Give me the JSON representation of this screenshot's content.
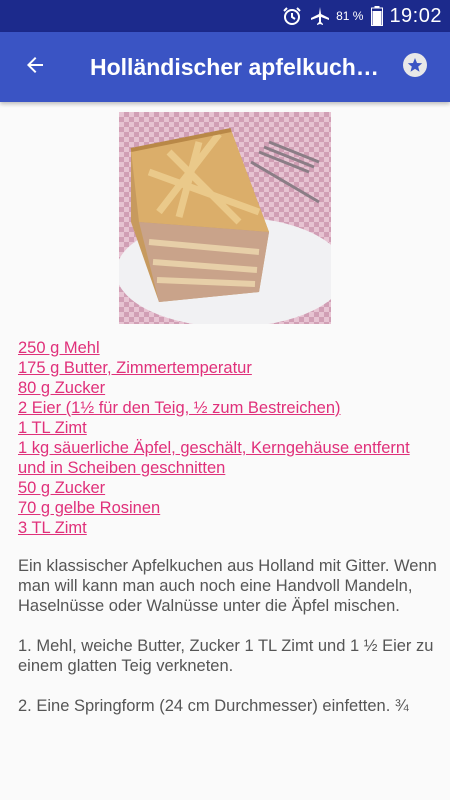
{
  "status_bar": {
    "battery_percent": "81 %",
    "time": "19:02",
    "icons": [
      "alarm-icon",
      "airplane-icon",
      "battery-icon"
    ]
  },
  "app_bar": {
    "title": "Holländischer apfelkuchen",
    "back_icon": "arrow-left-icon",
    "favorite_icon": "star-icon"
  },
  "recipe": {
    "image_alt": "Apfelkuchen",
    "ingredients": [
      "250 g Mehl",
      "175 g Butter, Zimmertemperatur",
      "80 g Zucker",
      "2 Eier (1½ für den Teig, ½ zum Bestreichen)",
      "1 TL Zimt",
      "1 kg säuerliche Äpfel, geschält, Kerngehäuse entfernt und in Scheiben geschnitten",
      "50 g Zucker",
      "70 g gelbe Rosinen",
      "3 TL Zimt"
    ],
    "description": "Ein klassischer Apfelkuchen aus Holland mit Gitter. Wenn man will kann man auch noch eine Handvoll Mandeln, Haselnüsse oder Walnüsse unter die Äpfel mischen.",
    "steps": [
      "1. Mehl, weiche Butter, Zucker 1 TL Zimt und 1 ½ Eier zu einem glatten Teig verkneten.",
      "2. Eine Springform (24 cm Durchmesser) einfetten. ¾"
    ]
  },
  "colors": {
    "status_bar": "#1c2a8c",
    "app_bar": "#3a54c4",
    "link": "#e0307a",
    "body_text": "#555555",
    "background": "#fafafa"
  }
}
